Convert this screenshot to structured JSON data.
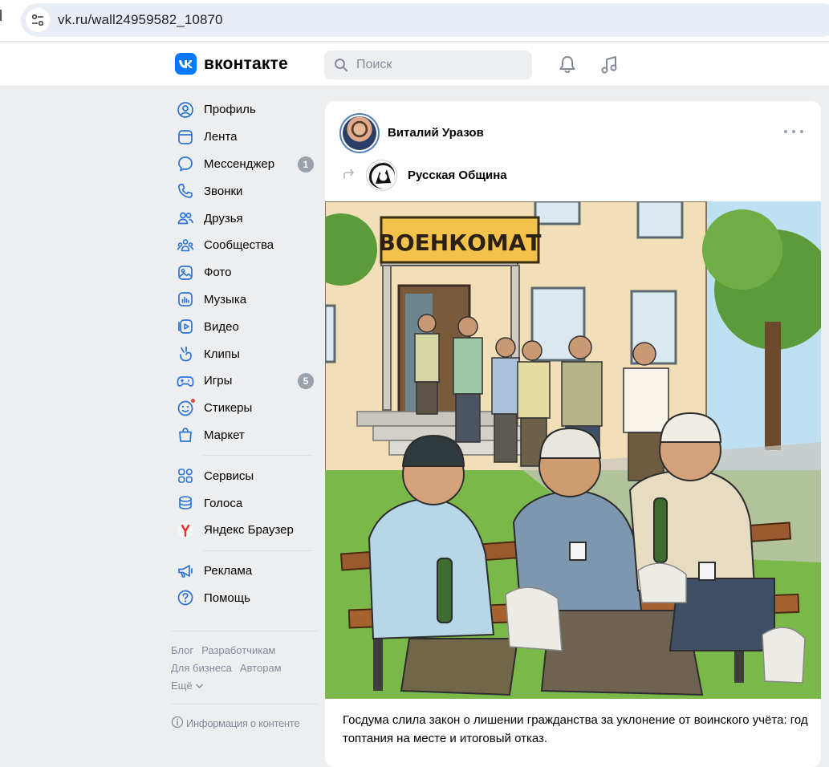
{
  "browser": {
    "url": "vk.ru/wall24959582_10870"
  },
  "header": {
    "logo_text": "вконтакте",
    "search_placeholder": "Поиск"
  },
  "nav": {
    "main": [
      {
        "label": "Профиль",
        "icon": "profile-icon"
      },
      {
        "label": "Лента",
        "icon": "feed-icon"
      },
      {
        "label": "Мессенджер",
        "icon": "messenger-icon",
        "badge": "1"
      },
      {
        "label": "Звонки",
        "icon": "phone-icon"
      },
      {
        "label": "Друзья",
        "icon": "friends-icon"
      },
      {
        "label": "Сообщества",
        "icon": "communities-icon"
      },
      {
        "label": "Фото",
        "icon": "photo-icon"
      },
      {
        "label": "Музыка",
        "icon": "music-icon"
      },
      {
        "label": "Видео",
        "icon": "video-icon"
      },
      {
        "label": "Клипы",
        "icon": "clips-icon"
      },
      {
        "label": "Игры",
        "icon": "games-icon",
        "badge": "5"
      },
      {
        "label": "Стикеры",
        "icon": "stickers-icon"
      },
      {
        "label": "Маркет",
        "icon": "market-icon"
      }
    ],
    "secondary": [
      {
        "label": "Сервисы",
        "icon": "services-icon"
      },
      {
        "label": "Голоса",
        "icon": "votes-icon"
      },
      {
        "label": "Яндекс Браузер",
        "icon": "yandex-browser-icon"
      }
    ],
    "tertiary": [
      {
        "label": "Реклама",
        "icon": "ads-icon"
      },
      {
        "label": "Помощь",
        "icon": "help-icon"
      }
    ]
  },
  "footer": {
    "blog": "Блог",
    "developers": "Разработчикам",
    "business": "Для бизнеса",
    "authors": "Авторам",
    "more": "Ещё",
    "content_info": "Информация о контенте"
  },
  "post": {
    "author": "Виталий Уразов",
    "repost_source": "Русская Община",
    "image_sign": "ВОЕНКОМАТ",
    "text": "Госдума слила закон о лишении гражданства за уклонение от воинского учёта: год топтания на месте и итоговый отказ."
  },
  "colors": {
    "vk_blue": "#0077ff",
    "page_bg": "#edeef0",
    "badge_grey": "#99a2ad",
    "secondary_text": "#818c99"
  }
}
